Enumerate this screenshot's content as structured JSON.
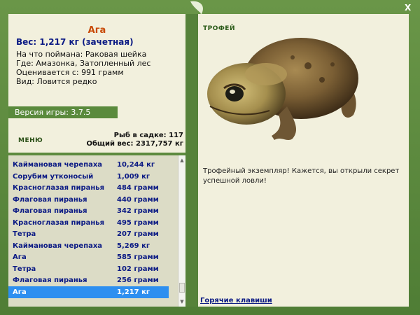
{
  "window": {
    "close_label": "X"
  },
  "fish": {
    "name": "Ага",
    "weight_line": "Вес: 1,217 кг (зачетная)",
    "bait_line": "На что поймана: Раковая шейка",
    "place_line": "Где: Амазонка, Затопленный лес",
    "value_line": "Оценивается с: 991 грамм",
    "type_line": "Вид: Ловится редко"
  },
  "version_text": "Версия игры: 3.7.5",
  "menu_label": "МЕНЮ",
  "stats": {
    "fish_in_cage": "Рыб в садке: 117",
    "total_weight": "Общий вес: 2317,757 кг"
  },
  "catches": [
    {
      "name": "Каймановая черепаха",
      "weight": "10,244 кг"
    },
    {
      "name": "Сорубим утконосый",
      "weight": "1,009 кг"
    },
    {
      "name": "Красноглазая пиранья",
      "weight": "484 грамм"
    },
    {
      "name": "Флаговая пиранья",
      "weight": "440 грамм"
    },
    {
      "name": "Флаговая пиранья",
      "weight": "342 грамм"
    },
    {
      "name": "Красноглазая пиранья",
      "weight": "495 грамм"
    },
    {
      "name": "Тетра",
      "weight": "207 грамм"
    },
    {
      "name": "Каймановая черепаха",
      "weight": "5,269 кг"
    },
    {
      "name": "Ага",
      "weight": "585 грамм"
    },
    {
      "name": "Тетра",
      "weight": "102 грамм"
    },
    {
      "name": "Флаговая пиранья",
      "weight": "256 грамм"
    },
    {
      "name": "Ага",
      "weight": "1,217 кг"
    }
  ],
  "selected_index": 11,
  "trophy": {
    "label": "ТРОФЕЙ",
    "message": "Трофейный экземпляр! Кажется, вы открыли секрет успешной ловли!",
    "hotkeys_link": "Горячие клавиши"
  },
  "colors": {
    "frame": "#56823a",
    "panel": "#f2f0dd",
    "accent_title": "#c84a06",
    "text_blue": "#0b1a84",
    "selection": "#2d8ff0"
  }
}
